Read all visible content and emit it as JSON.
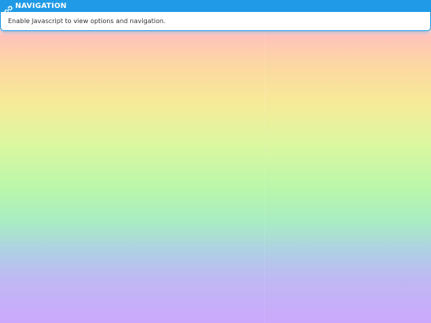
{
  "navigation": {
    "title": "NAVIGATION",
    "icon": "link-icon",
    "message": "Enable Javascript to view options and navigation."
  },
  "colors": {
    "header_blue": "#1f9ae6",
    "text": "#333333",
    "gradient": [
      "#ffc3bb",
      "#f6eb99",
      "#baf7aa",
      "#aed0e4",
      "#cba8fb"
    ]
  }
}
